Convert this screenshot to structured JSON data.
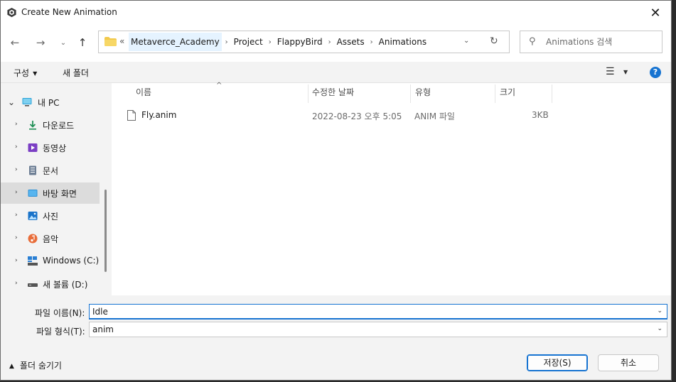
{
  "window": {
    "title": "Create New Animation",
    "close_glyph": "✕"
  },
  "nav": {
    "back_glyph": "←",
    "forward_glyph": "→",
    "recent_glyph": "⌄",
    "up_glyph": "↑",
    "chevrons": "«",
    "breadcrumbs": [
      "Metaverce_Academy",
      "Project",
      "FlappyBird",
      "Assets",
      "Animations"
    ],
    "crumb_sep": "›",
    "dropdown_glyph": "⌄",
    "refresh_glyph": "↻",
    "search_placeholder": "Animations 검색",
    "search_glyph": "⚲"
  },
  "toolbar": {
    "organize": "구성",
    "organize_arrow": "▼",
    "new_folder": "새 폴더",
    "view_glyph": "☰",
    "view_arrow": "▼",
    "help": "?"
  },
  "sidebar": {
    "items": [
      {
        "label": "내 PC",
        "arrow": "⌄",
        "icon": "pc-icon"
      },
      {
        "label": "다운로드",
        "arrow": "›",
        "icon": "download-icon"
      },
      {
        "label": "동영상",
        "arrow": "›",
        "icon": "video-icon"
      },
      {
        "label": "문서",
        "arrow": "›",
        "icon": "document-icon"
      },
      {
        "label": "바탕 화면",
        "arrow": "›",
        "icon": "desktop-icon",
        "selected": true
      },
      {
        "label": "사진",
        "arrow": "›",
        "icon": "pictures-icon"
      },
      {
        "label": "음악",
        "arrow": "›",
        "icon": "music-icon"
      },
      {
        "label": "Windows (C:)",
        "arrow": "›",
        "icon": "drive-c-icon"
      },
      {
        "label": "새 볼륨 (D:)",
        "arrow": "›",
        "icon": "drive-d-icon"
      }
    ]
  },
  "file_list": {
    "columns": [
      "이름",
      "수정한 날짜",
      "유형",
      "크기"
    ],
    "sort_caret": "^",
    "rows": [
      {
        "name": "Fly.anim",
        "modified": "2022-08-23 오후 5:05",
        "type": "ANIM 파일",
        "size": "3KB"
      }
    ]
  },
  "form": {
    "filename_label": "파일 이름(N):",
    "filename_value": "Idle",
    "filetype_label": "파일 형식(T):",
    "filetype_value": "anim",
    "dropdown_glyph": "⌄",
    "hide_folders": "폴더 숨기기",
    "hide_arrow": "▲",
    "save": "저장(S)",
    "cancel": "취소"
  },
  "colors": {
    "accent": "#1673d1",
    "folder": "#f2c94c",
    "selection": "#e5f3ff"
  }
}
